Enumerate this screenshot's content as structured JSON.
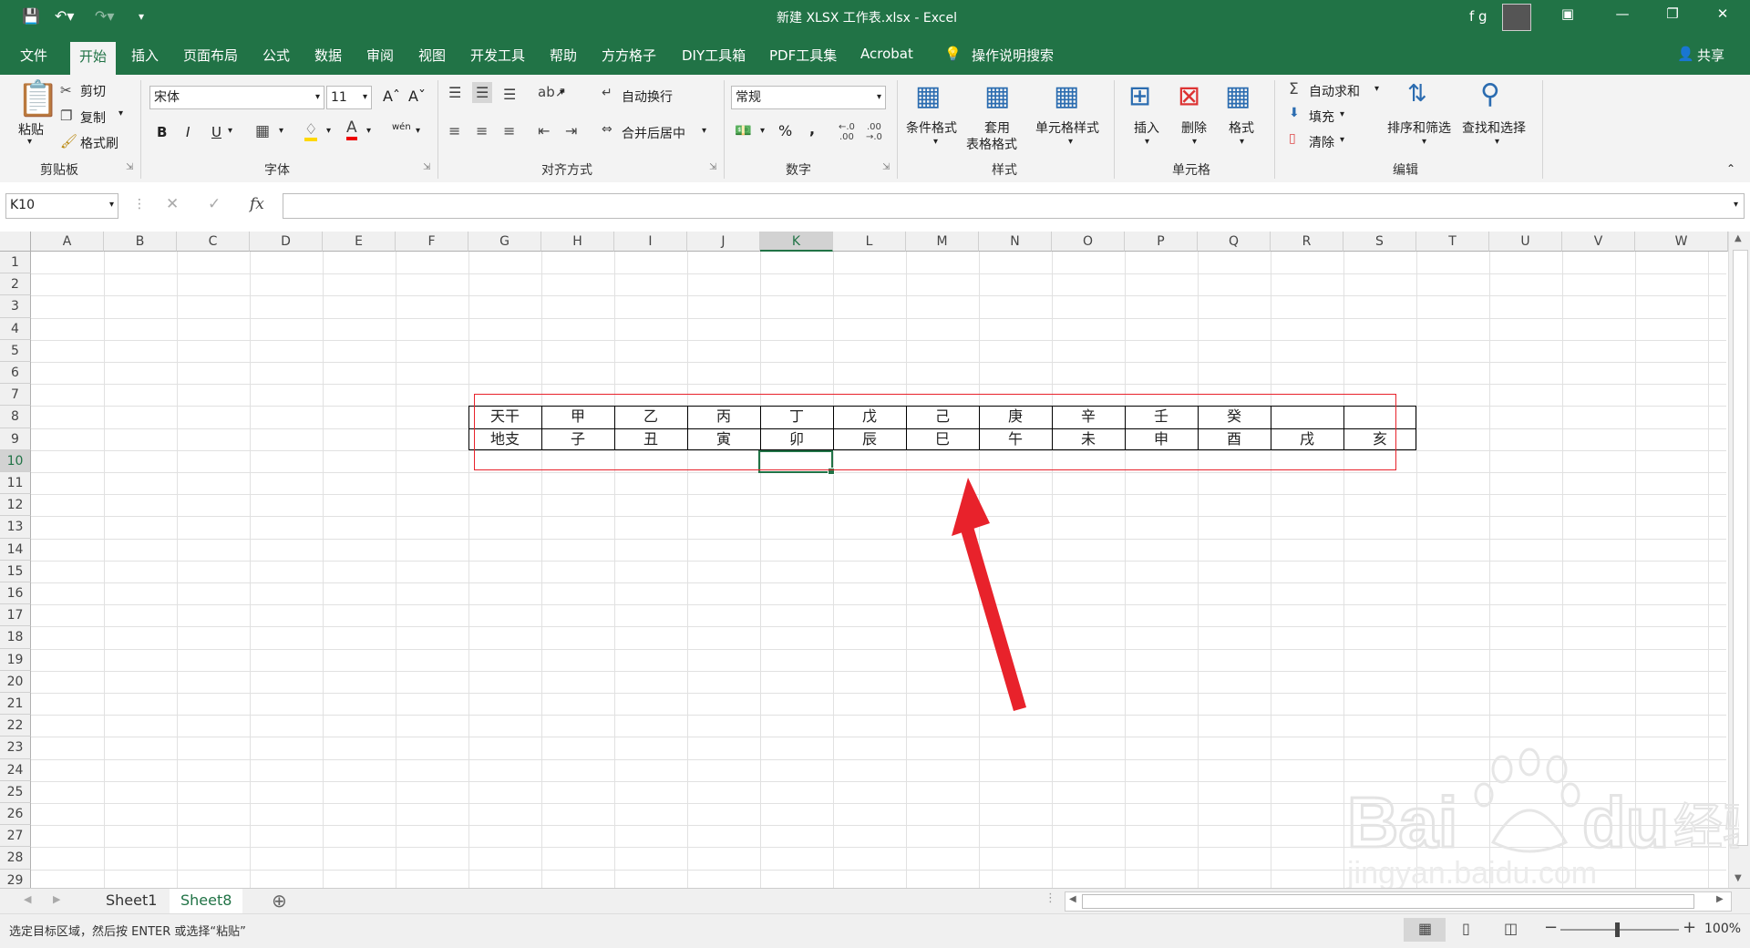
{
  "window": {
    "title": "新建 XLSX 工作表.xlsx  -  Excel",
    "user": "f g"
  },
  "tabs": [
    "文件",
    "开始",
    "插入",
    "页面布局",
    "公式",
    "数据",
    "审阅",
    "视图",
    "开发工具",
    "帮助",
    "方方格子",
    "DIY工具箱",
    "PDF工具集",
    "Acrobat"
  ],
  "active_tab": "开始",
  "tell_me": "操作说明搜索",
  "share": "共享",
  "ribbon": {
    "clipboard": {
      "paste": "粘贴",
      "cut": "剪切",
      "copy": "复制",
      "format_painter": "格式刷",
      "label": "剪贴板"
    },
    "font": {
      "name": "宋体",
      "size": "11",
      "label": "字体",
      "bold": "B",
      "italic": "I",
      "underline": "U",
      "phonetic": "wén"
    },
    "alignment": {
      "wrap": "自动换行",
      "merge": "合并后居中",
      "label": "对齐方式"
    },
    "number": {
      "format": "常规",
      "percent": "%",
      "comma": ",",
      "label": "数字"
    },
    "styles": {
      "conditional": "条件格式",
      "table_line1": "套用",
      "table_line2": "表格格式",
      "cell_styles": "单元格样式",
      "label": "样式"
    },
    "cells": {
      "insert": "插入",
      "delete": "删除",
      "format": "格式",
      "label": "单元格"
    },
    "editing": {
      "autosum": "自动求和",
      "fill": "填充",
      "clear": "清除",
      "sort": "排序和筛选",
      "find": "查找和选择",
      "label": "编辑"
    }
  },
  "name_box": "K10",
  "columns": [
    "A",
    "B",
    "C",
    "D",
    "E",
    "F",
    "G",
    "H",
    "I",
    "J",
    "K",
    "L",
    "M",
    "N",
    "O",
    "P",
    "Q",
    "R",
    "S",
    "T",
    "U",
    "V",
    "W"
  ],
  "selected_column": "K",
  "rows": [
    "1",
    "2",
    "3",
    "4",
    "5",
    "6",
    "7",
    "8",
    "9",
    "10",
    "11",
    "12",
    "13",
    "14",
    "15",
    "16",
    "17",
    "18",
    "19",
    "20",
    "21",
    "22",
    "23",
    "24",
    "25",
    "26",
    "27",
    "28",
    "29"
  ],
  "selected_row": "10",
  "table": {
    "row8": [
      "天干",
      "甲",
      "乙",
      "丙",
      "丁",
      "戊",
      "己",
      "庚",
      "辛",
      "壬",
      "癸",
      "",
      ""
    ],
    "row9": [
      "地支",
      "子",
      "丑",
      "寅",
      "卯",
      "辰",
      "巳",
      "午",
      "未",
      "申",
      "酉",
      "戌",
      "亥"
    ]
  },
  "sheets": [
    "Sheet1",
    "Sheet8"
  ],
  "active_sheet": "Sheet8",
  "status": "选定目标区域，然后按 ENTER 或选择“粘贴”",
  "zoom": "100%",
  "colors": {
    "excel_green": "#217346",
    "annotation_red": "#e8222b"
  },
  "watermark": "Baidu经验 jingyan.baidu.com"
}
